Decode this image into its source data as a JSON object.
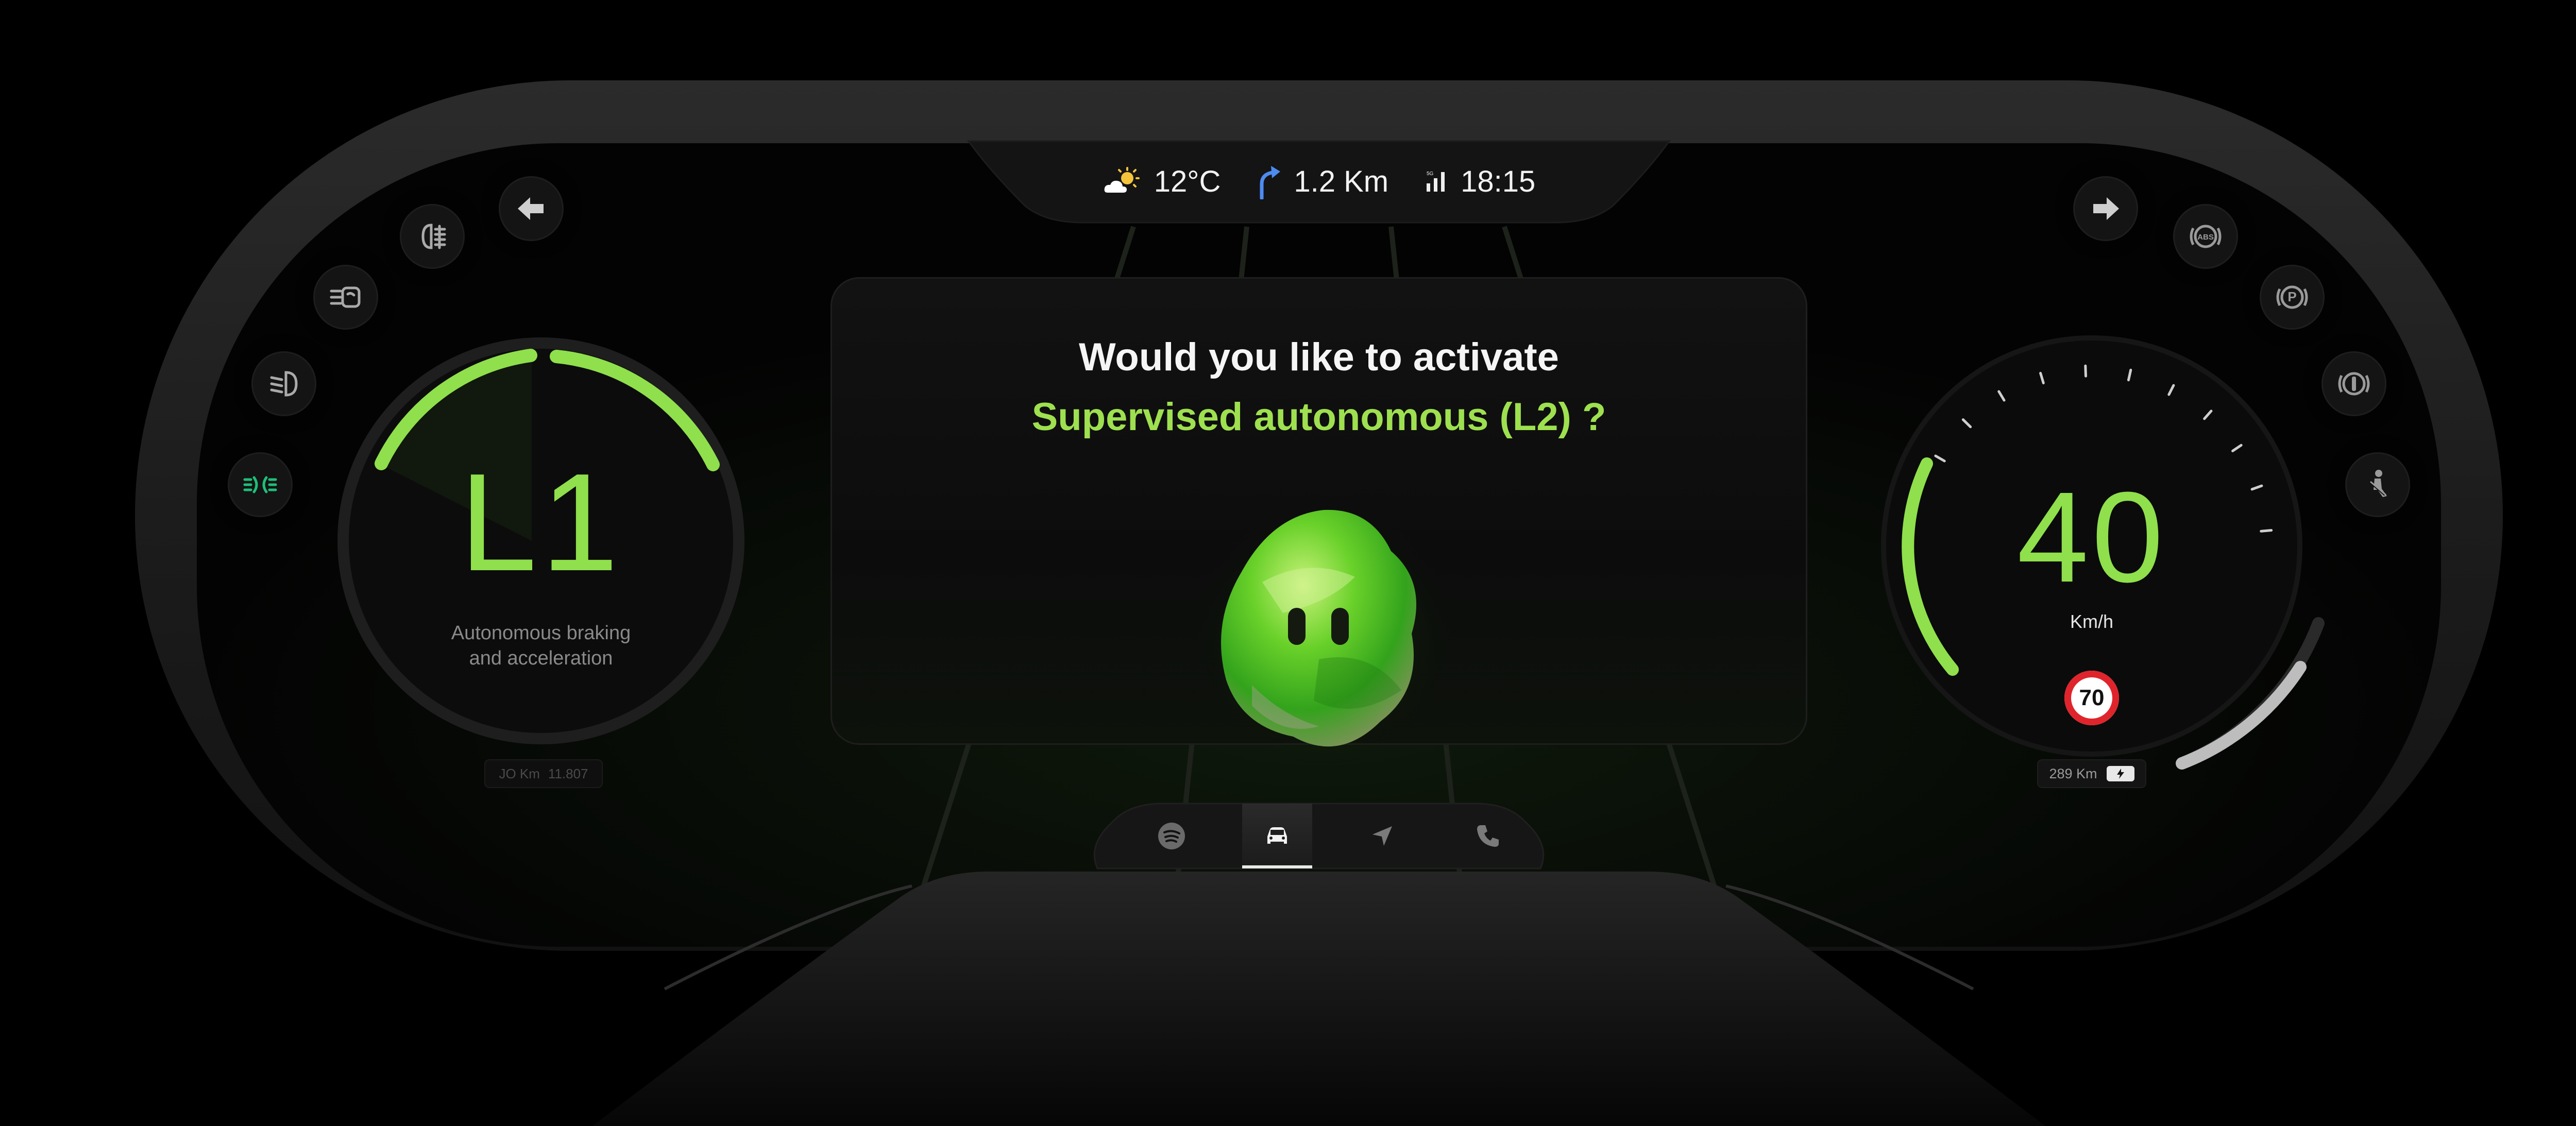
{
  "status_bar": {
    "temperature": "12°C",
    "distance": "1.2 Km",
    "time": "18:15"
  },
  "autonomy": {
    "level": "L1",
    "description_line1": "Autonomous braking",
    "description_line2": "and acceleration",
    "odometer_label": "JO Km",
    "odometer_value": "11.807"
  },
  "prompt": {
    "line1": "Would you like to activate",
    "line2": "Supervised autonomous (L2) ?"
  },
  "speedometer": {
    "speed": "40",
    "unit": "Km/h",
    "speed_limit": "70",
    "range": "289 Km"
  },
  "icons": {
    "left": [
      "turn-left-arrow-icon",
      "fog-light-icon",
      "rear-wiper-icon",
      "low-beam-icon",
      "parking-lights-icon"
    ],
    "right": [
      "turn-right-arrow-icon",
      "abs-warning-icon",
      "parking-brake-icon",
      "brake-warning-icon",
      "seatbelt-warning-icon"
    ],
    "nav": [
      "spotify-icon",
      "car-icon",
      "navigation-icon",
      "phone-icon"
    ]
  },
  "colors": {
    "accent_green": "#8fe04c",
    "prompt_green": "#9ee04f",
    "active_light_green": "#1fbf7a",
    "limit_red": "#e0242b"
  }
}
